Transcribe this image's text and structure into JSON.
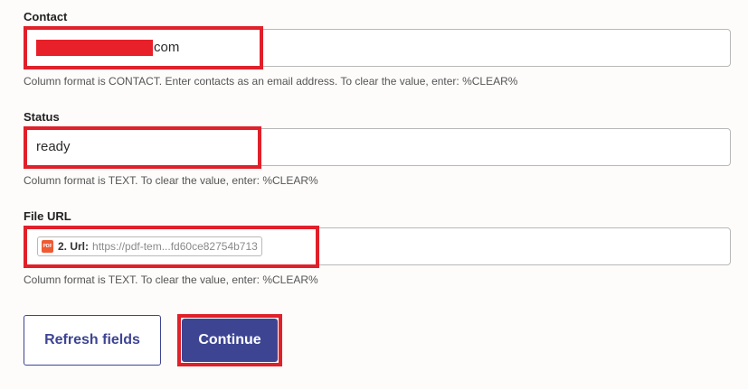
{
  "fields": [
    {
      "label": "Contact",
      "value": "com",
      "help": "Column format is CONTACT. Enter contacts as an email address. To clear the value, enter: %CLEAR%"
    },
    {
      "label": "Status",
      "value": "ready",
      "help": "Column format is TEXT. To clear the value, enter: %CLEAR%"
    },
    {
      "label": "File URL",
      "chip": {
        "icon": "pdf-icon",
        "icon_text": "PDF",
        "key": "2. Url:",
        "value": "https://pdf-tem...fd60ce82754b713"
      },
      "help": "Column format is TEXT. To clear the value, enter: %CLEAR%"
    }
  ],
  "buttons": {
    "refresh_label": "Refresh fields",
    "continue_label": "Continue"
  },
  "colors": {
    "highlight": "#e0202a",
    "primary": "#3d4593",
    "pdf_icon": "#ef5a33"
  }
}
